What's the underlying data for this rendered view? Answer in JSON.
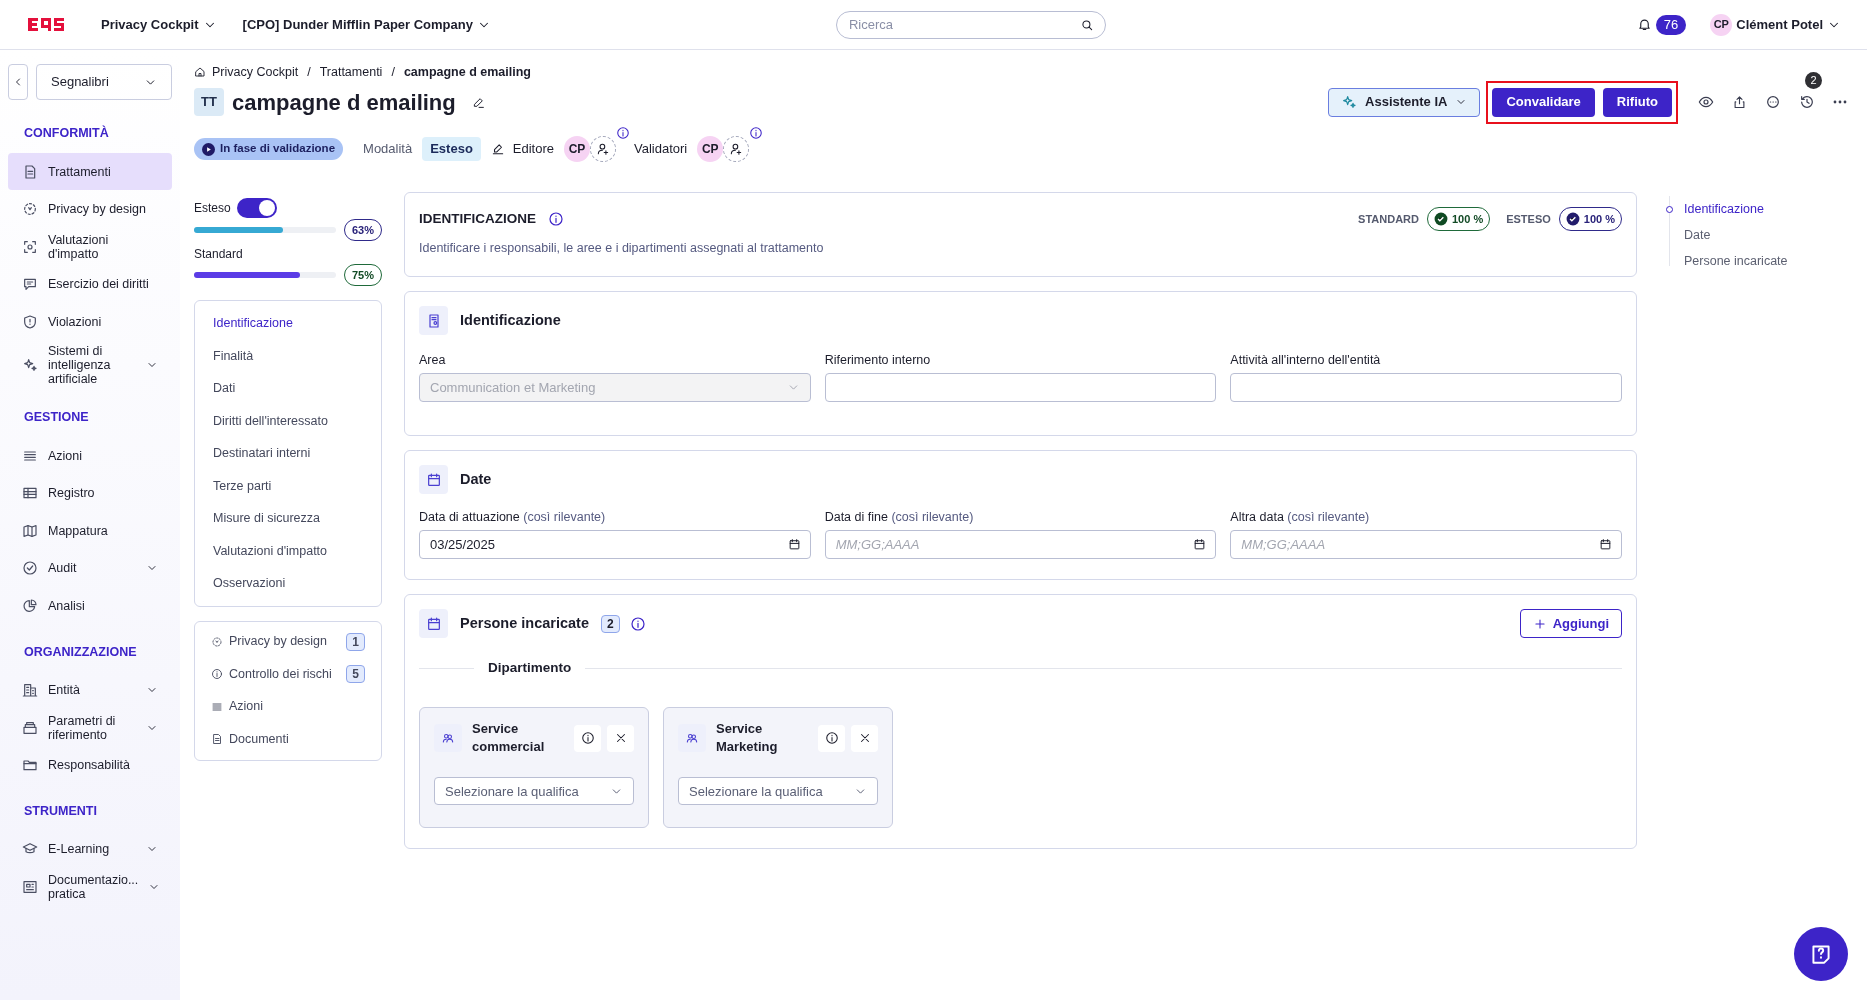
{
  "topbar": {
    "module": "Privacy Cockpit",
    "company": "[CPO] Dunder Mifflin Paper Company",
    "search": {
      "placeholder": "Ricerca"
    },
    "notifications": "76",
    "user": {
      "initials": "CP",
      "name": "Clément Potel"
    }
  },
  "sidebar": {
    "bookmarks": "Segnalibri",
    "sections": [
      {
        "title": "CONFORMITÀ",
        "items": [
          {
            "label": "Trattamenti",
            "selected": true,
            "collapsible": false
          },
          {
            "label": "Privacy by design",
            "selected": false,
            "collapsible": false
          },
          {
            "label": "Valutazioni d'impatto",
            "selected": false,
            "collapsible": false
          },
          {
            "label": "Esercizio dei diritti",
            "selected": false,
            "collapsible": false
          },
          {
            "label": "Violazioni",
            "selected": false,
            "collapsible": false
          },
          {
            "label": "Sistemi di intelligenza artificiale",
            "selected": false,
            "collapsible": true
          }
        ]
      },
      {
        "title": "GESTIONE",
        "items": [
          {
            "label": "Azioni",
            "selected": false,
            "collapsible": false
          },
          {
            "label": "Registro",
            "selected": false,
            "collapsible": false
          },
          {
            "label": "Mappatura",
            "selected": false,
            "collapsible": false
          },
          {
            "label": "Audit",
            "selected": false,
            "collapsible": true
          },
          {
            "label": "Analisi",
            "selected": false,
            "collapsible": false
          }
        ]
      },
      {
        "title": "ORGANIZZAZIONE",
        "items": [
          {
            "label": "Entità",
            "selected": false,
            "collapsible": true
          },
          {
            "label": "Parametri di riferimento",
            "selected": false,
            "collapsible": true
          },
          {
            "label": "Responsabilità",
            "selected": false,
            "collapsible": false
          }
        ]
      },
      {
        "title": "STRUMENTI",
        "items": [
          {
            "label": "E-Learning",
            "selected": false,
            "collapsible": true
          },
          {
            "label": "Documentazio... pratica",
            "selected": false,
            "collapsible": true
          }
        ]
      }
    ]
  },
  "breadcrumb": [
    "Privacy Cockpit",
    "Trattamenti",
    "campagne d emailing"
  ],
  "breadcrumb_separator": "/",
  "record": {
    "badge": "TT",
    "title": "campagne d emailing",
    "status": "In fase di validazione",
    "mode_label": "Modalità",
    "mode": "Esteso",
    "editor_label": "Editore",
    "editor_initials": "CP",
    "validators_label": "Validatori",
    "validator_initials": "CP"
  },
  "actions": {
    "assistant": "Assistente IA",
    "validate": "Convalidare",
    "reject": "Rifiuto",
    "history_count": "2"
  },
  "progress": [
    {
      "label": "Esteso",
      "kind": "extended",
      "level": 0.63,
      "reading": "63%",
      "color": "#36a9d3",
      "toggle": {
        "on": true
      }
    },
    {
      "label": "Standard",
      "kind": "standard",
      "level": 0.75,
      "reading": "75%",
      "color": "#5b3ce6"
    }
  ],
  "section_nav": [
    {
      "label": "Identificazione",
      "selected": true
    },
    {
      "label": "Finalità",
      "selected": false
    },
    {
      "label": "Dati",
      "selected": false
    },
    {
      "label": "Diritti dell'interessato",
      "selected": false
    },
    {
      "label": "Destinatari interni",
      "selected": false
    },
    {
      "label": "Terze parti",
      "selected": false
    },
    {
      "label": "Misure di sicurezza",
      "selected": false
    },
    {
      "label": "Valutazioni d'impatto",
      "selected": false
    },
    {
      "label": "Osservazioni",
      "selected": false
    }
  ],
  "links": [
    {
      "label": "Privacy by design",
      "count": "1"
    },
    {
      "label": "Controllo dei rischi",
      "count": "5"
    },
    {
      "label": "Azioni"
    },
    {
      "label": "Documenti"
    }
  ],
  "intro": {
    "title": "IDENTIFICAZIONE",
    "description": "Identificare i responsabili, le aree e i dipartimenti assegnati al trattamento",
    "scores": [
      {
        "label": "STANDARD",
        "value": "100 %",
        "kind": "standard"
      },
      {
        "label": "ESTESO",
        "value": "100 %",
        "kind": "extended"
      }
    ]
  },
  "identification": {
    "title": "Identificazione",
    "fields": [
      {
        "label": "Area",
        "kind": "select",
        "value": "Communication et Marketing",
        "disabled": true
      },
      {
        "label": "Riferimento interno",
        "kind": "text",
        "disabled": false
      },
      {
        "label": "Attività all'interno dell'entità",
        "kind": "text",
        "disabled": false
      }
    ]
  },
  "dates": {
    "title": "Date",
    "fields": [
      {
        "label": "Data di attuazione",
        "hint": "(così rilevante)",
        "value": "03/25/2025"
      },
      {
        "label": "Data di fine",
        "hint": "(così rilevante)",
        "placeholder": "MM;GG;AAAA"
      },
      {
        "label": "Altra data",
        "hint": "(così rilevante)",
        "placeholder": "MM;GG;AAAA"
      }
    ]
  },
  "people": {
    "title": "Persone incaricate",
    "count": "2",
    "add": "Aggiungi",
    "group": "Dipartimento",
    "departments": [
      {
        "name": "Service commercial",
        "placeholder": "Selezionare la qualifica"
      },
      {
        "name": "Service Marketing",
        "placeholder": "Selezionare la qualifica"
      }
    ]
  },
  "page_nav": [
    {
      "label": "Identificazione",
      "selected": true
    },
    {
      "label": "Date",
      "selected": false
    },
    {
      "label": "Persone incaricate",
      "selected": false
    }
  ]
}
